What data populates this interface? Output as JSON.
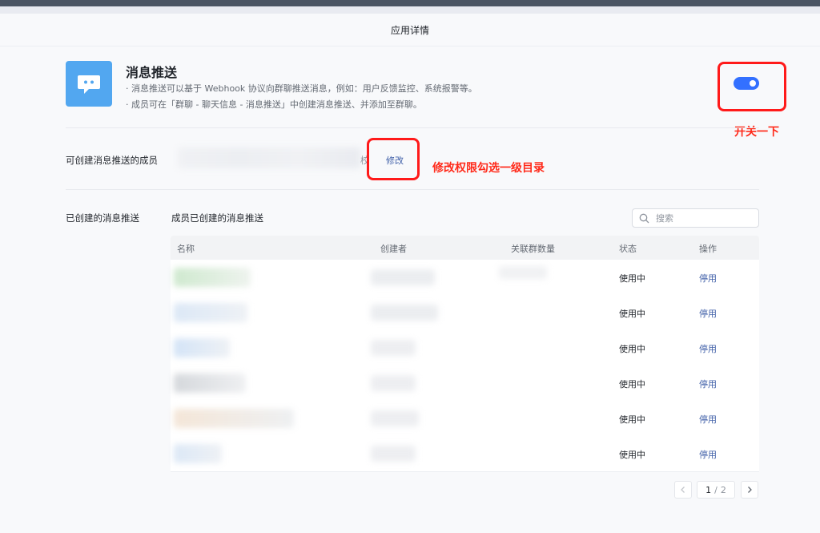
{
  "header": {
    "title": "应用详情"
  },
  "app": {
    "name": "消息推送",
    "desc_line1": "· 消息推送可以基于 Webhook 协议向群聊推送消息，例如：用户反馈监控、系统报警等。",
    "desc_line2": "· 成员可在「群聊 - 聊天信息 - 消息推送」中创建消息推送、并添加至群聊。",
    "enabled": true
  },
  "members": {
    "label": "可创建消息推送的成员",
    "trailing_char": "校",
    "edit_label": "修改"
  },
  "annotations": {
    "toggle_note": "开关一下",
    "edit_note": "修改权限勾选一级目录"
  },
  "created": {
    "label": "已创建的消息推送",
    "subtitle": "成员已创建的消息推送",
    "search_placeholder": "搜索",
    "columns": [
      "名称",
      "创建者",
      "关联群数量",
      "状态",
      "操作"
    ],
    "rows": [
      {
        "status": "使用中",
        "action": "停用"
      },
      {
        "status": "使用中",
        "action": "停用"
      },
      {
        "status": "使用中",
        "action": "停用"
      },
      {
        "status": "使用中",
        "action": "停用"
      },
      {
        "status": "使用中",
        "action": "停用"
      },
      {
        "status": "使用中",
        "action": "停用"
      }
    ]
  },
  "pagination": {
    "current": "1",
    "separator": "/",
    "total": "2"
  },
  "colors": {
    "accent": "#3370ff",
    "annotation": "#ff1a1a",
    "app_icon": "#52a7f0",
    "link": "#3f5fa8"
  }
}
